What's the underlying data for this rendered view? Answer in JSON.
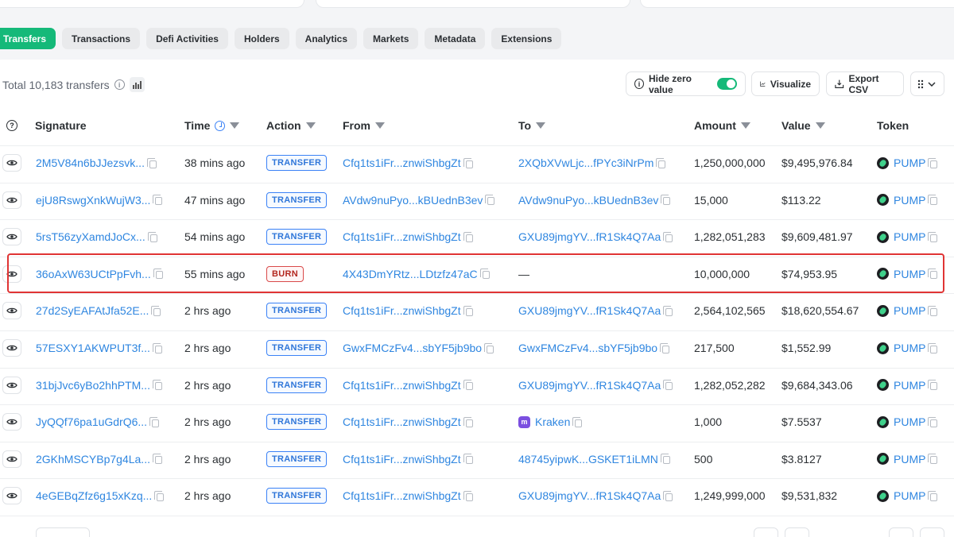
{
  "tabs": [
    {
      "label": "Transfers",
      "active": true
    },
    {
      "label": "Transactions",
      "active": false
    },
    {
      "label": "Defi Activities",
      "active": false
    },
    {
      "label": "Holders",
      "active": false
    },
    {
      "label": "Analytics",
      "active": false
    },
    {
      "label": "Markets",
      "active": false
    },
    {
      "label": "Metadata",
      "active": false
    },
    {
      "label": "Extensions",
      "active": false
    }
  ],
  "summary": {
    "total_text": "Total 10,183 transfers"
  },
  "toolbar": {
    "hide_zero_label": "Hide zero value",
    "hide_zero_enabled": true,
    "visualize_label": "Visualize",
    "export_label": "Export CSV"
  },
  "columns": {
    "signature": "Signature",
    "time": "Time",
    "action": "Action",
    "from": "From",
    "to": "To",
    "amount": "Amount",
    "value": "Value",
    "token": "Token"
  },
  "rows": [
    {
      "signature": "2M5V84n6bJJezsvk...",
      "time": "38 mins ago",
      "action": "TRANSFER",
      "from": "Cfq1ts1iFr...znwiShbgZt",
      "to": "2XQbXVwLjc...fPYc3iNrPm",
      "amount": "1,250,000,000",
      "value": "$9,495,976.84",
      "token": "PUMP"
    },
    {
      "signature": "ejU8RswgXnkWujW3...",
      "time": "47 mins ago",
      "action": "TRANSFER",
      "from": "AVdw9nuPyo...kBUednB3ev",
      "to": "AVdw9nuPyo...kBUednB3ev",
      "amount": "15,000",
      "value": "$113.22",
      "token": "PUMP"
    },
    {
      "signature": "5rsT56zyXamdJoCx...",
      "time": "54 mins ago",
      "action": "TRANSFER",
      "from": "Cfq1ts1iFr...znwiShbgZt",
      "to": "GXU89jmgYV...fR1Sk4Q7Aa",
      "amount": "1,282,051,283",
      "value": "$9,609,481.97",
      "token": "PUMP"
    },
    {
      "signature": "36oAxW63UCtPpFvh...",
      "time": "55 mins ago",
      "action": "BURN",
      "from": "4X43DmYRtz...LDtzfz47aC",
      "to": "—",
      "amount": "10,000,000",
      "value": "$74,953.95",
      "token": "PUMP"
    },
    {
      "signature": "27d2SyEAFAtJfa52E...",
      "time": "2 hrs ago",
      "action": "TRANSFER",
      "from": "Cfq1ts1iFr...znwiShbgZt",
      "to": "GXU89jmgYV...fR1Sk4Q7Aa",
      "amount": "2,564,102,565",
      "value": "$18,620,554.67",
      "token": "PUMP"
    },
    {
      "signature": "57ESXY1AKWPUT3f...",
      "time": "2 hrs ago",
      "action": "TRANSFER",
      "from": "GwxFMCzFv4...sbYF5jb9bo",
      "to": "GwxFMCzFv4...sbYF5jb9bo",
      "amount": "217,500",
      "value": "$1,552.99",
      "token": "PUMP"
    },
    {
      "signature": "31bjJvc6yBo2hhPTM...",
      "time": "2 hrs ago",
      "action": "TRANSFER",
      "from": "Cfq1ts1iFr...znwiShbgZt",
      "to": "GXU89jmgYV...fR1Sk4Q7Aa",
      "amount": "1,282,052,282",
      "value": "$9,684,343.06",
      "token": "PUMP"
    },
    {
      "signature": "JyQQf76pa1uGdrQ6...",
      "time": "2 hrs ago",
      "action": "TRANSFER",
      "from": "Cfq1ts1iFr...znwiShbgZt",
      "to": "Kraken",
      "amount": "1,000",
      "value": "$7.5537",
      "token": "PUMP"
    },
    {
      "signature": "2GKhMSCYBp7g4La...",
      "time": "2 hrs ago",
      "action": "TRANSFER",
      "from": "Cfq1ts1iFr...znwiShbgZt",
      "to": "48745yipwK...GSKET1iLMN",
      "amount": "500",
      "value": "$3.8127",
      "token": "PUMP"
    },
    {
      "signature": "4eGEBqZfz6g15xKzq...",
      "time": "2 hrs ago",
      "action": "TRANSFER",
      "from": "Cfq1ts1iFr...znwiShbgZt",
      "to": "GXU89jmgYV...fR1Sk4Q7Aa",
      "amount": "1,249,999,000",
      "value": "$9,531,832",
      "token": "PUMP"
    }
  ],
  "colors": {
    "accent": "#15b979",
    "link": "#2f86e0",
    "highlight": "#e03434"
  }
}
